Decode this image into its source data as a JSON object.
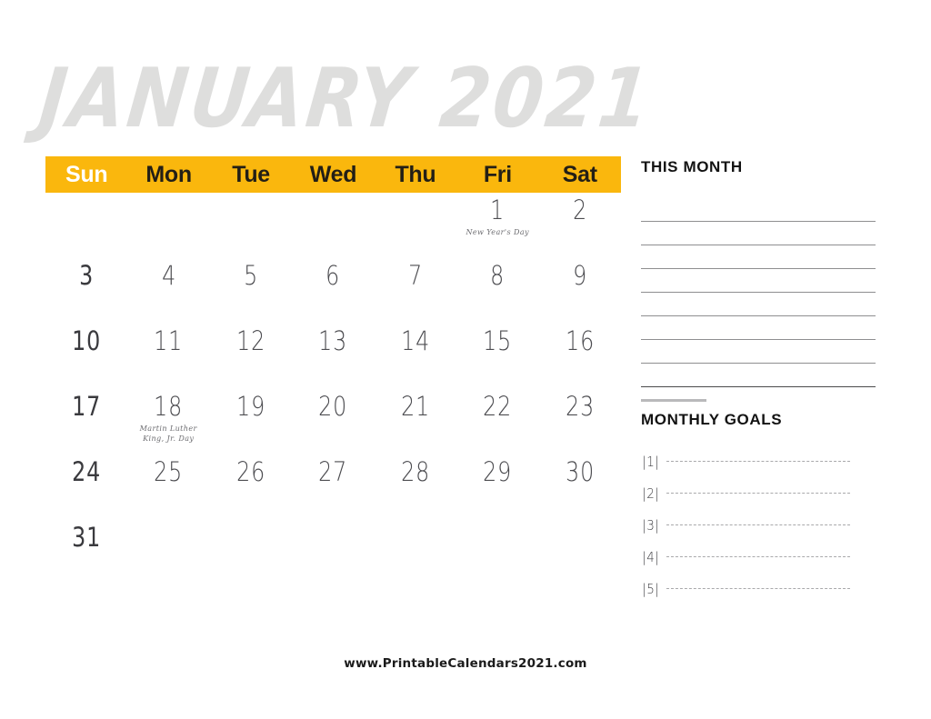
{
  "title": "JANUARY 2021",
  "month": "January",
  "year": "2021",
  "colors": {
    "header_bar": "#FAB70D",
    "title_gray": "#DEDEDD",
    "sunday_label": "#FFFFFF",
    "weekday_label": "#231F16",
    "day_number": "#4C4C50",
    "rule_line": "#8E8E90",
    "dashed_line": "#A9A9AB"
  },
  "weekdays": [
    {
      "label": "Sun",
      "highlight": true
    },
    {
      "label": "Mon",
      "highlight": false
    },
    {
      "label": "Tue",
      "highlight": false
    },
    {
      "label": "Wed",
      "highlight": false
    },
    {
      "label": "Thu",
      "highlight": false
    },
    {
      "label": "Fri",
      "highlight": false
    },
    {
      "label": "Sat",
      "highlight": false
    }
  ],
  "weeks": [
    [
      {
        "day": ""
      },
      {
        "day": ""
      },
      {
        "day": ""
      },
      {
        "day": ""
      },
      {
        "day": ""
      },
      {
        "day": "1",
        "event": "New Year's Day"
      },
      {
        "day": "2"
      }
    ],
    [
      {
        "day": "3"
      },
      {
        "day": "4"
      },
      {
        "day": "5"
      },
      {
        "day": "6"
      },
      {
        "day": "7"
      },
      {
        "day": "8"
      },
      {
        "day": "9"
      }
    ],
    [
      {
        "day": "10"
      },
      {
        "day": "11"
      },
      {
        "day": "12"
      },
      {
        "day": "13"
      },
      {
        "day": "14"
      },
      {
        "day": "15"
      },
      {
        "day": "16"
      }
    ],
    [
      {
        "day": "17"
      },
      {
        "day": "18",
        "event": "Martin Luther\nKing, Jr. Day"
      },
      {
        "day": "19"
      },
      {
        "day": "20"
      },
      {
        "day": "21"
      },
      {
        "day": "22"
      },
      {
        "day": "23"
      }
    ],
    [
      {
        "day": "24"
      },
      {
        "day": "25"
      },
      {
        "day": "26"
      },
      {
        "day": "27"
      },
      {
        "day": "28"
      },
      {
        "day": "29"
      },
      {
        "day": "30"
      }
    ],
    [
      {
        "day": "31"
      },
      {
        "day": ""
      },
      {
        "day": ""
      },
      {
        "day": ""
      },
      {
        "day": ""
      },
      {
        "day": ""
      },
      {
        "day": ""
      }
    ]
  ],
  "this_month": {
    "heading": "THIS MONTH",
    "line_count": 8,
    "has_stub_line": true
  },
  "monthly_goals": {
    "heading": "MONTHLY GOALS",
    "items": [
      {
        "marker": "|1|"
      },
      {
        "marker": "|2|"
      },
      {
        "marker": "|3|"
      },
      {
        "marker": "|4|"
      },
      {
        "marker": "|5|"
      }
    ]
  },
  "footer": "www.PrintableCalendars2021.com"
}
